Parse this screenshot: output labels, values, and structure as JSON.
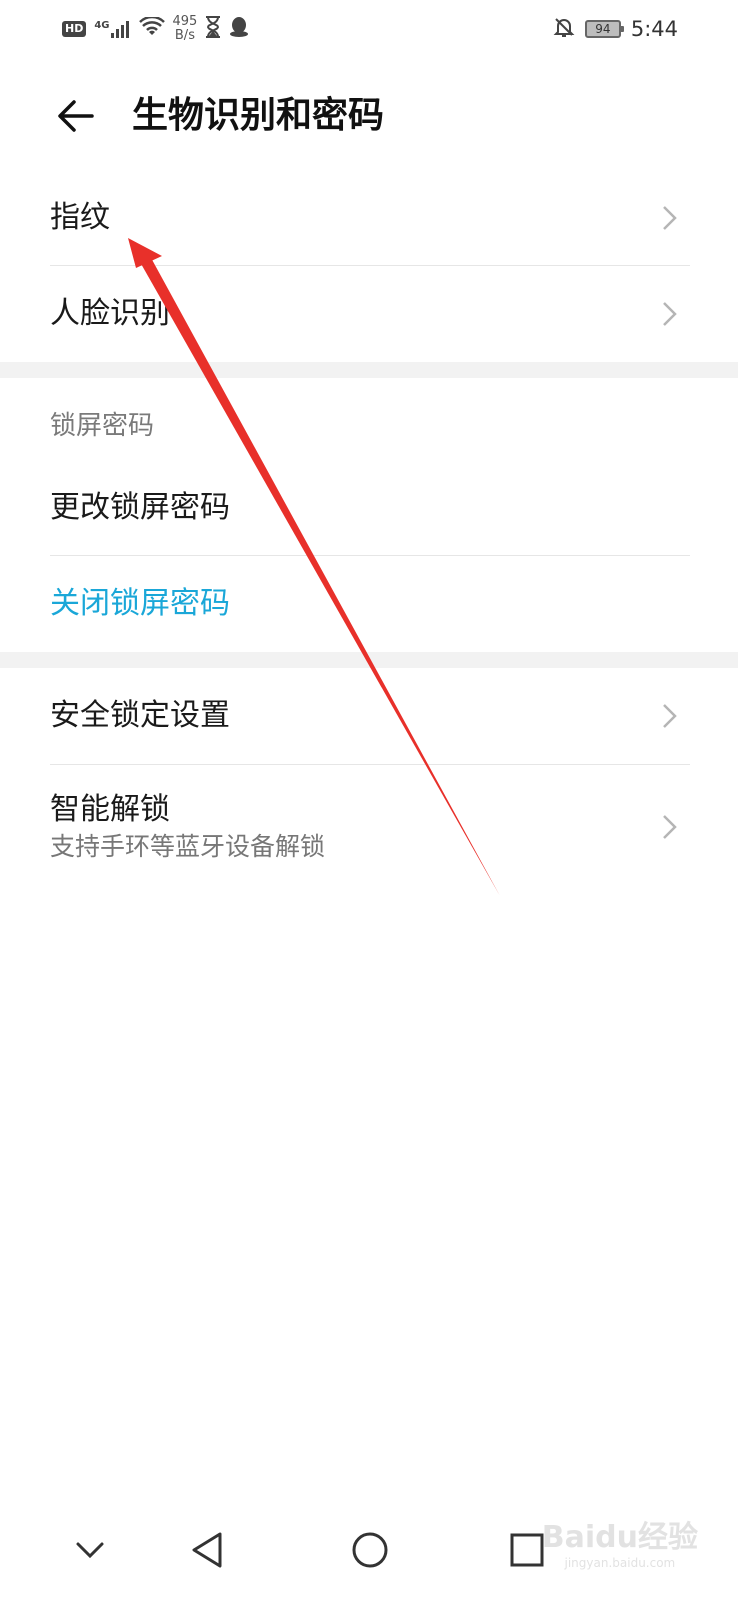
{
  "status_bar": {
    "hd": "HD",
    "net": "4G",
    "speed_value": "495",
    "speed_unit": "B/s",
    "battery": "94",
    "time": "5:44"
  },
  "header": {
    "title": "生物识别和密码"
  },
  "items": {
    "fingerprint": "指纹",
    "face": "人脸识别",
    "lock_section": "锁屏密码",
    "change_password": "更改锁屏密码",
    "close_password": "关闭锁屏密码",
    "security_lock": "安全锁定设置",
    "smart_unlock": "智能解锁",
    "smart_unlock_sub": "支持手环等蓝牙设备解锁"
  },
  "colors": {
    "accent": "#1aa7d8",
    "annotation": "#e8302a"
  },
  "watermark": {
    "main": "Baidu经验",
    "sub": "jingyan.baidu.com"
  }
}
